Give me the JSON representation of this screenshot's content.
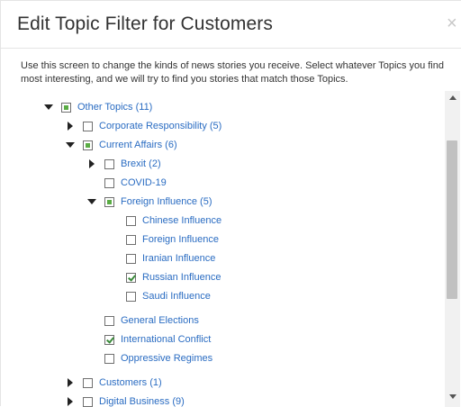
{
  "dialog": {
    "title": "Edit Topic Filter for Customers",
    "close_glyph": "×",
    "description": "Use this screen to change the kinds of news stories you receive. Select whatever Topics you find most interesting, and we will try to find you stories that match those Topics."
  },
  "tree": [
    {
      "id": "other-topics",
      "label": "Other Topics (11)",
      "depth": 0,
      "toggle": "expanded",
      "state": "partial"
    },
    {
      "id": "corporate-responsibility",
      "label": "Corporate Responsibility (5)",
      "depth": 1,
      "toggle": "collapsed",
      "state": "unchecked"
    },
    {
      "id": "current-affairs",
      "label": "Current Affairs (6)",
      "depth": 1,
      "toggle": "expanded",
      "state": "partial"
    },
    {
      "id": "brexit",
      "label": "Brexit (2)",
      "depth": 2,
      "toggle": "collapsed",
      "state": "unchecked"
    },
    {
      "id": "covid-19",
      "label": "COVID-19",
      "depth": 2,
      "toggle": "none",
      "state": "unchecked"
    },
    {
      "id": "foreign-influence",
      "label": "Foreign Influence (5)",
      "depth": 2,
      "toggle": "expanded",
      "state": "partial"
    },
    {
      "id": "chinese-influence",
      "label": "Chinese Influence",
      "depth": 3,
      "toggle": "none",
      "state": "unchecked"
    },
    {
      "id": "foreign-influence-leaf",
      "label": "Foreign Influence",
      "depth": 3,
      "toggle": "none",
      "state": "unchecked"
    },
    {
      "id": "iranian-influence",
      "label": "Iranian Influence",
      "depth": 3,
      "toggle": "none",
      "state": "unchecked"
    },
    {
      "id": "russian-influence",
      "label": "Russian Influence",
      "depth": 3,
      "toggle": "none",
      "state": "checked"
    },
    {
      "id": "saudi-influence",
      "label": "Saudi Influence",
      "depth": 3,
      "toggle": "none",
      "state": "unchecked"
    },
    {
      "id": "general-elections",
      "label": "General Elections",
      "depth": 2,
      "toggle": "none",
      "state": "unchecked"
    },
    {
      "id": "international-conflict",
      "label": "International Conflict",
      "depth": 2,
      "toggle": "none",
      "state": "checked"
    },
    {
      "id": "oppressive-regimes",
      "label": "Oppressive Regimes",
      "depth": 2,
      "toggle": "none",
      "state": "unchecked"
    },
    {
      "id": "customers",
      "label": "Customers (1)",
      "depth": 1,
      "toggle": "collapsed",
      "state": "unchecked"
    },
    {
      "id": "digital-business",
      "label": "Digital Business (9)",
      "depth": 1,
      "toggle": "collapsed",
      "state": "unchecked"
    }
  ],
  "colors": {
    "link": "#2a6cc2",
    "check_green": "#5aac44"
  }
}
